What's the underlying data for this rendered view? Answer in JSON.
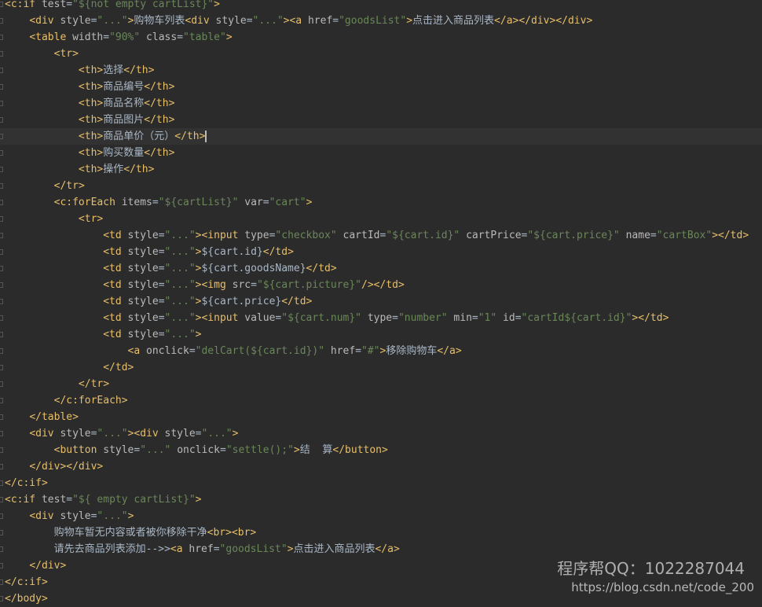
{
  "editor": {
    "lines": [
      "<c:if test=\"${not empty cartList}\">",
      "    <div style=\"...\">购物车列表<div style=\"...\"><a href=\"goodsList\">点击进入商品列表</a></div></div>",
      "    <table width=\"90%\" class=\"table\">",
      "        <tr>",
      "            <th>选择</th>",
      "            <th>商品编号</th>",
      "            <th>商品名称</th>",
      "            <th>商品图片</th>",
      "            <th>商品单价（元）</th>",
      "            <th>购买数量</th>",
      "            <th>操作</th>",
      "        </tr>",
      "        <c:forEach items=\"${cartList}\" var=\"cart\">",
      "            <tr>",
      "                <td style=\"...\"><input type=\"checkbox\" cartId=\"${cart.id}\" cartPrice=\"${cart.price}\" name=\"cartBox\"></td>",
      "                <td style=\"...\">${cart.id}</td>",
      "                <td style=\"...\">${cart.goodsName}</td>",
      "                <td style=\"...\"><img src=\"${cart.picture}\"/></td>",
      "                <td style=\"...\">${cart.price}</td>",
      "                <td style=\"...\"><input value=\"${cart.num}\" type=\"number\" min=\"1\" id=\"cartId${cart.id}\"></td>",
      "                <td style=\"...\">",
      "                    <a onclick=\"delCart(${cart.id})\" href=\"#\">移除购物车</a>",
      "                </td>",
      "            </tr>",
      "        </c:forEach>",
      "    </table>",
      "    <div style=\"...\"><div style=\"...\">",
      "        <button style=\"...\" onclick=\"settle();\">结  算</button>",
      "    </div></div>",
      "</c:if>",
      "<c:if test=\"${ empty cartList}\">",
      "    <div style=\"...\">",
      "        购物车暂无内容或者被你移除干净<br><br>",
      "        请先去商品列表添加-->><a href=\"goodsList\">点击进入商品列表</a>",
      "    </div>",
      "</c:if>",
      "</body>"
    ],
    "caret_line_index": 8
  },
  "watermark": {
    "qq_text": "程序帮QQ：1022287044",
    "url_text": "https://blog.csdn.net/code_200"
  }
}
